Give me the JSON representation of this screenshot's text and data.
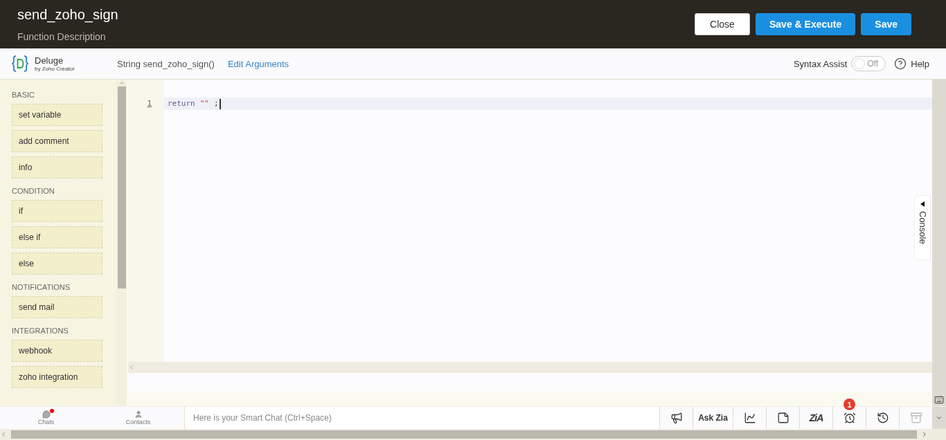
{
  "header": {
    "title": "send_zoho_sign",
    "description": "Function Description",
    "buttons": [
      {
        "label": "Close",
        "kind": "secondary"
      },
      {
        "label": "Save & Execute",
        "kind": "primary"
      },
      {
        "label": "Save",
        "kind": "primary"
      }
    ]
  },
  "toolbar": {
    "logo": {
      "name": "Deluge",
      "subtitle": "by Zoho Creator"
    },
    "signature": "String send_zoho_sign()",
    "edit_link": "Edit Arguments",
    "syntax_assist": {
      "label": "Syntax Assist",
      "on": false,
      "state_text": "Off"
    },
    "help": "Help"
  },
  "sidebar": {
    "sections": [
      {
        "heading": "BASIC",
        "items": [
          "set variable",
          "add comment",
          "info"
        ]
      },
      {
        "heading": "CONDITION",
        "items": [
          "if",
          "else if",
          "else"
        ]
      },
      {
        "heading": "NOTIFICATIONS",
        "items": [
          "send mail"
        ]
      },
      {
        "heading": "INTEGRATIONS",
        "items": [
          "webhook",
          "zoho integration"
        ]
      }
    ]
  },
  "editor": {
    "lines": [
      {
        "number": "1",
        "active": true,
        "tokens": [
          {
            "kind": "keyword",
            "text": "return"
          },
          {
            "kind": "string",
            "text": "\"\""
          },
          {
            "kind": "punct",
            "text": ";"
          }
        ]
      }
    ]
  },
  "console_tab": {
    "label": "Console"
  },
  "chat_bar": {
    "tabs": [
      {
        "label": "Chats",
        "kind": "chats",
        "unread": true
      },
      {
        "label": "Contacts",
        "kind": "contacts",
        "unread": false
      }
    ],
    "placeholder": "Here is your Smart Chat (Ctrl+Space)",
    "tools": [
      {
        "kind": "megaphone"
      },
      {
        "kind": "text",
        "label": "Ask Zia"
      },
      {
        "kind": "chart"
      },
      {
        "kind": "note"
      },
      {
        "kind": "logo",
        "label": "ZiA"
      },
      {
        "kind": "alarm",
        "badge": "1"
      },
      {
        "kind": "history"
      },
      {
        "kind": "archive",
        "disabled": true
      }
    ]
  }
}
